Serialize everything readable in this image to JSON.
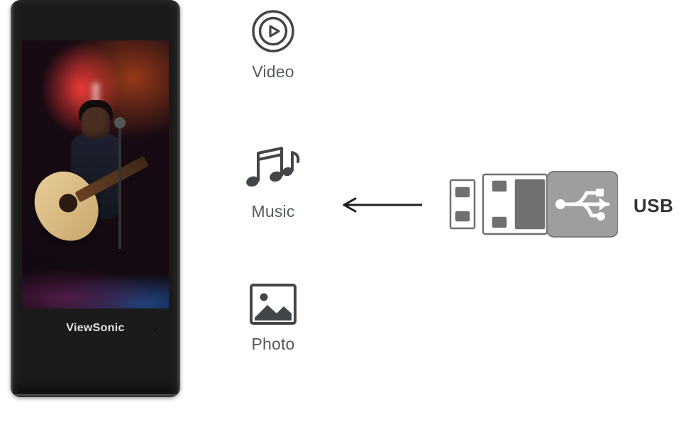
{
  "kiosk": {
    "brand": "ViewSonic"
  },
  "media": {
    "video": {
      "label": "Video",
      "icon": "play-circle-icon"
    },
    "music": {
      "label": "Music",
      "icon": "music-notes-icon"
    },
    "photo": {
      "label": "Photo",
      "icon": "image-icon"
    }
  },
  "source": {
    "label": "USB",
    "icon": "usb-drive-icon"
  },
  "flow": {
    "arrow": "arrow-left-icon"
  }
}
